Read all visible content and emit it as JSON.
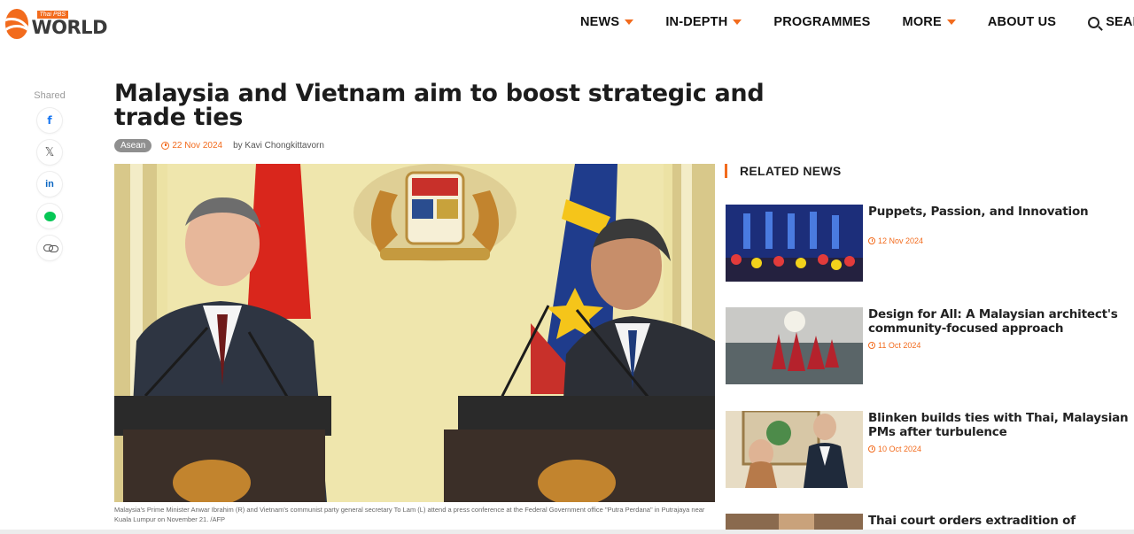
{
  "header": {
    "logo_tag": "Thai PBS",
    "logo_word": "WORLD",
    "nav": [
      {
        "label": "NEWS",
        "has_dropdown": true
      },
      {
        "label": "IN-DEPTH",
        "has_dropdown": true
      },
      {
        "label": "PROGRAMMES",
        "has_dropdown": false
      },
      {
        "label": "MORE",
        "has_dropdown": true
      },
      {
        "label": "ABOUT US",
        "has_dropdown": false
      }
    ],
    "search_label": "SEARCH"
  },
  "share": {
    "label": "Shared",
    "buttons": [
      {
        "name": "facebook-icon",
        "glyph": "f"
      },
      {
        "name": "x-icon",
        "glyph": "𝕏"
      },
      {
        "name": "linkedin-icon",
        "glyph": "in"
      },
      {
        "name": "line-icon",
        "glyph": ""
      },
      {
        "name": "link-icon",
        "glyph": ""
      }
    ]
  },
  "article": {
    "title": "Malaysia and Vietnam aim to boost strategic and trade ties",
    "category": "Asean",
    "date": "22 Nov 2024",
    "byline": "by Kavi Chongkittavorn",
    "caption": "Malaysia's Prime Minister Anwar Ibrahim (R) and Vietnam's communist party general secretary To Lam (L) attend a press conference at the Federal Government office \"Putra Perdana\" in Putrajaya near Kuala Lumpur on November 21. /AFP"
  },
  "related": {
    "heading": "RELATED NEWS",
    "items": [
      {
        "headline": "Puppets, Passion, and Innovation",
        "date": "12 Nov 2024"
      },
      {
        "headline": "Design for All: A Malaysian architect's community-focused approach",
        "date": "11 Oct 2024"
      },
      {
        "headline": "Blinken builds ties with Thai, Malaysian PMs after turbulence",
        "date": "10 Oct 2024"
      },
      {
        "headline": "Thai court orders extradition of Vietnam",
        "date": ""
      }
    ]
  },
  "colors": {
    "accent": "#f26b1d",
    "text": "#1c1c1c",
    "tag_bg": "#8f8f8f"
  }
}
